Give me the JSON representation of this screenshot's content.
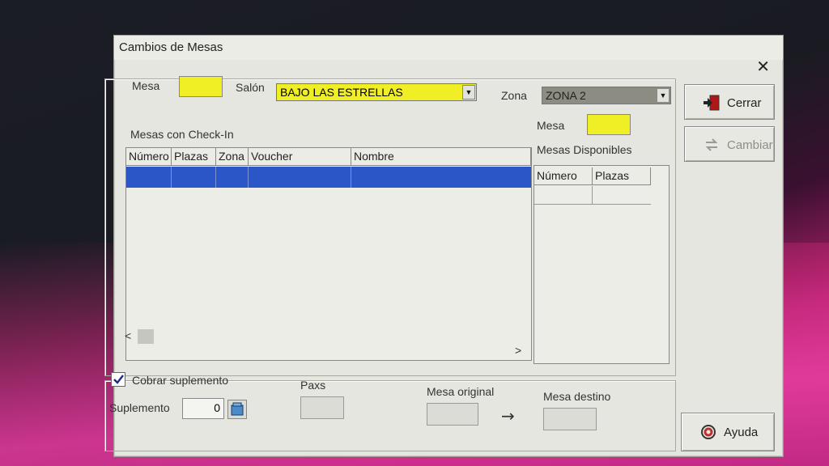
{
  "window": {
    "title": "Cambios de Mesas",
    "close_icon": "close-icon"
  },
  "top": {
    "mesa_label": "Mesa",
    "mesa_value": "",
    "salon_label": "Salón",
    "salon_value": "BAJO LAS ESTRELLAS",
    "zona_label": "Zona",
    "zona_value": "ZONA 2"
  },
  "checkin": {
    "label": "Mesas con Check-In",
    "columns": [
      "Número",
      "Plazas",
      "Zona",
      "Voucher",
      "Nombre"
    ],
    "rows": [
      [
        "",
        "",
        "",
        "",
        ""
      ]
    ],
    "scroll_left": "<",
    "scroll_right": ">"
  },
  "disponibles": {
    "mesa_label": "Mesa",
    "mesa_value": "",
    "label": "Mesas Disponibles",
    "columns": [
      "Número",
      "Plazas"
    ],
    "rows": [
      [
        "",
        ""
      ]
    ]
  },
  "bottom": {
    "cobrar_label": "Cobrar suplemento",
    "cobrar_checked": true,
    "suplemento_label": "Suplemento",
    "suplemento_value": "0",
    "paxs_label": "Paxs",
    "mesa_original_label": "Mesa original",
    "arrow": "→",
    "mesa_destino_label": "Mesa destino"
  },
  "buttons": {
    "cerrar": "Cerrar",
    "cambiar": "Cambiar",
    "ayuda": "Ayuda"
  },
  "colors": {
    "highlight_yellow": "#f0ee24",
    "selection_blue": "#2a56c8",
    "zona_gray": "#8c8c82"
  }
}
